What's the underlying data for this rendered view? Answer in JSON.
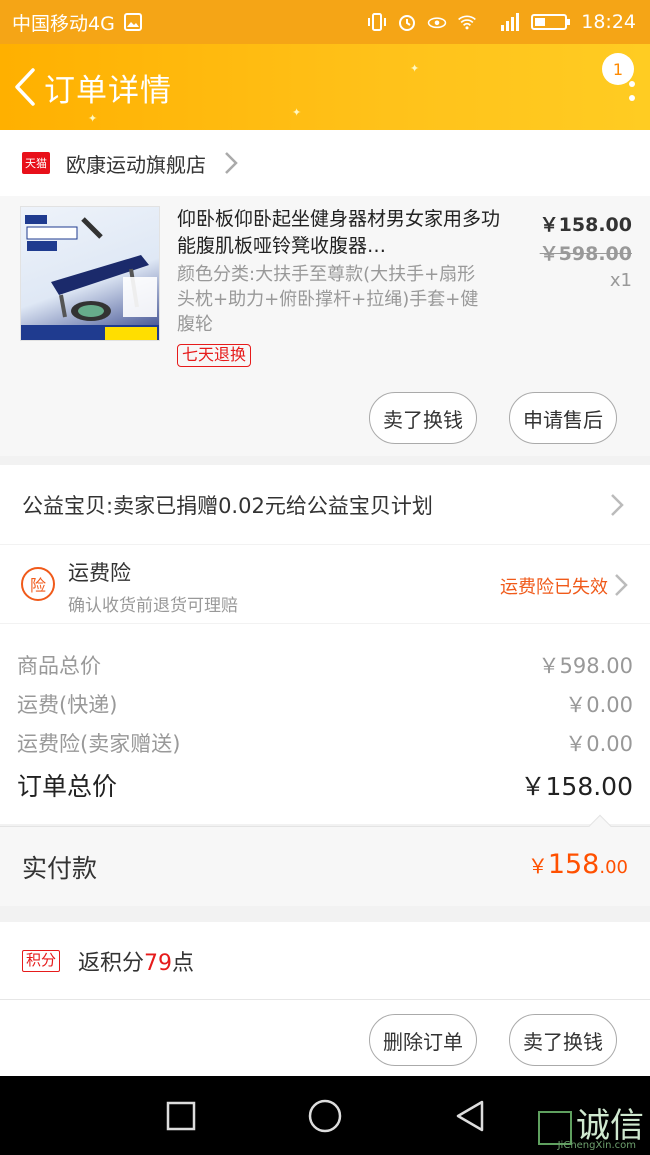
{
  "status_bar": {
    "carrier": "中国移动4G",
    "network": "4G",
    "time": "18:24"
  },
  "header": {
    "title": "订单详情",
    "badge_count": "1",
    "back_icon": "chevron-left-icon",
    "more_icon": "more-vertical-icon"
  },
  "shop": {
    "tag": "天猫",
    "name": "欧康运动旗舰店"
  },
  "product": {
    "title": "仰卧板仰卧起坐健身器材男女家用多功能腹肌板哑铃凳收腹器…",
    "sku": "颜色分类:大扶手至尊款(大扶手+扇形头枕+助力+俯卧撑杆+拉绳)手套+健腹轮",
    "return_tag": "七天退换",
    "price": "￥158.00",
    "original_price": "￥598.00",
    "quantity": "x1",
    "buttons": {
      "resell": "卖了换钱",
      "after_sale": "申请售后"
    }
  },
  "charity": {
    "text": "公益宝贝:卖家已捐赠0.02元给公益宝贝计划"
  },
  "insurance": {
    "icon_text": "险",
    "title": "运费险",
    "subtitle": "确认收货前退货可理赔",
    "status": "运费险已失效"
  },
  "summary": {
    "rows": [
      {
        "label": "商品总价",
        "value": "￥598.00"
      },
      {
        "label": "运费(快递)",
        "value": "￥0.00"
      },
      {
        "label": "运费险(卖家赠送)",
        "value": "￥0.00"
      }
    ],
    "total_label": "订单总价",
    "total_value": "￥158.00"
  },
  "paid": {
    "label": "实付款",
    "currency": "￥",
    "integer": "158",
    "decimal": ".00"
  },
  "points": {
    "tag": "积分",
    "prefix": "返积分",
    "number": "79",
    "suffix": "点"
  },
  "actions": {
    "delete": "删除订单",
    "resell": "卖了换钱"
  },
  "watermark": {
    "text": "诚信",
    "sub": "JiChengXin.com"
  },
  "colors": {
    "header": "#ffb000",
    "accent_orange": "#ff5000",
    "tmall_red": "#e8101a"
  }
}
